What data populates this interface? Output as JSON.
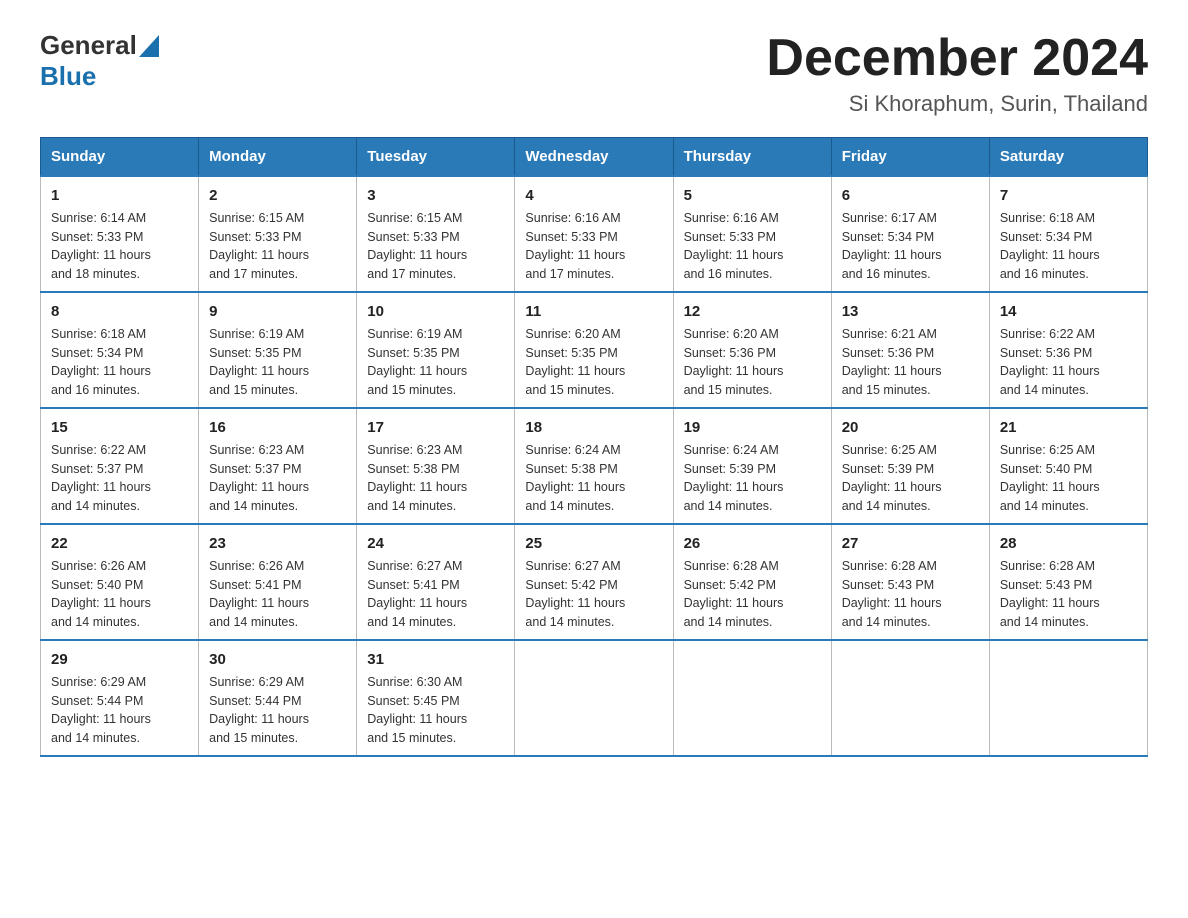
{
  "header": {
    "logo_general": "General",
    "logo_blue": "Blue",
    "month_year": "December 2024",
    "location": "Si Khoraphum, Surin, Thailand"
  },
  "days_of_week": [
    "Sunday",
    "Monday",
    "Tuesday",
    "Wednesday",
    "Thursday",
    "Friday",
    "Saturday"
  ],
  "weeks": [
    [
      {
        "day": "1",
        "sunrise": "6:14 AM",
        "sunset": "5:33 PM",
        "daylight": "11 hours and 18 minutes."
      },
      {
        "day": "2",
        "sunrise": "6:15 AM",
        "sunset": "5:33 PM",
        "daylight": "11 hours and 17 minutes."
      },
      {
        "day": "3",
        "sunrise": "6:15 AM",
        "sunset": "5:33 PM",
        "daylight": "11 hours and 17 minutes."
      },
      {
        "day": "4",
        "sunrise": "6:16 AM",
        "sunset": "5:33 PM",
        "daylight": "11 hours and 17 minutes."
      },
      {
        "day": "5",
        "sunrise": "6:16 AM",
        "sunset": "5:33 PM",
        "daylight": "11 hours and 16 minutes."
      },
      {
        "day": "6",
        "sunrise": "6:17 AM",
        "sunset": "5:34 PM",
        "daylight": "11 hours and 16 minutes."
      },
      {
        "day": "7",
        "sunrise": "6:18 AM",
        "sunset": "5:34 PM",
        "daylight": "11 hours and 16 minutes."
      }
    ],
    [
      {
        "day": "8",
        "sunrise": "6:18 AM",
        "sunset": "5:34 PM",
        "daylight": "11 hours and 16 minutes."
      },
      {
        "day": "9",
        "sunrise": "6:19 AM",
        "sunset": "5:35 PM",
        "daylight": "11 hours and 15 minutes."
      },
      {
        "day": "10",
        "sunrise": "6:19 AM",
        "sunset": "5:35 PM",
        "daylight": "11 hours and 15 minutes."
      },
      {
        "day": "11",
        "sunrise": "6:20 AM",
        "sunset": "5:35 PM",
        "daylight": "11 hours and 15 minutes."
      },
      {
        "day": "12",
        "sunrise": "6:20 AM",
        "sunset": "5:36 PM",
        "daylight": "11 hours and 15 minutes."
      },
      {
        "day": "13",
        "sunrise": "6:21 AM",
        "sunset": "5:36 PM",
        "daylight": "11 hours and 15 minutes."
      },
      {
        "day": "14",
        "sunrise": "6:22 AM",
        "sunset": "5:36 PM",
        "daylight": "11 hours and 14 minutes."
      }
    ],
    [
      {
        "day": "15",
        "sunrise": "6:22 AM",
        "sunset": "5:37 PM",
        "daylight": "11 hours and 14 minutes."
      },
      {
        "day": "16",
        "sunrise": "6:23 AM",
        "sunset": "5:37 PM",
        "daylight": "11 hours and 14 minutes."
      },
      {
        "day": "17",
        "sunrise": "6:23 AM",
        "sunset": "5:38 PM",
        "daylight": "11 hours and 14 minutes."
      },
      {
        "day": "18",
        "sunrise": "6:24 AM",
        "sunset": "5:38 PM",
        "daylight": "11 hours and 14 minutes."
      },
      {
        "day": "19",
        "sunrise": "6:24 AM",
        "sunset": "5:39 PM",
        "daylight": "11 hours and 14 minutes."
      },
      {
        "day": "20",
        "sunrise": "6:25 AM",
        "sunset": "5:39 PM",
        "daylight": "11 hours and 14 minutes."
      },
      {
        "day": "21",
        "sunrise": "6:25 AM",
        "sunset": "5:40 PM",
        "daylight": "11 hours and 14 minutes."
      }
    ],
    [
      {
        "day": "22",
        "sunrise": "6:26 AM",
        "sunset": "5:40 PM",
        "daylight": "11 hours and 14 minutes."
      },
      {
        "day": "23",
        "sunrise": "6:26 AM",
        "sunset": "5:41 PM",
        "daylight": "11 hours and 14 minutes."
      },
      {
        "day": "24",
        "sunrise": "6:27 AM",
        "sunset": "5:41 PM",
        "daylight": "11 hours and 14 minutes."
      },
      {
        "day": "25",
        "sunrise": "6:27 AM",
        "sunset": "5:42 PM",
        "daylight": "11 hours and 14 minutes."
      },
      {
        "day": "26",
        "sunrise": "6:28 AM",
        "sunset": "5:42 PM",
        "daylight": "11 hours and 14 minutes."
      },
      {
        "day": "27",
        "sunrise": "6:28 AM",
        "sunset": "5:43 PM",
        "daylight": "11 hours and 14 minutes."
      },
      {
        "day": "28",
        "sunrise": "6:28 AM",
        "sunset": "5:43 PM",
        "daylight": "11 hours and 14 minutes."
      }
    ],
    [
      {
        "day": "29",
        "sunrise": "6:29 AM",
        "sunset": "5:44 PM",
        "daylight": "11 hours and 14 minutes."
      },
      {
        "day": "30",
        "sunrise": "6:29 AM",
        "sunset": "5:44 PM",
        "daylight": "11 hours and 15 minutes."
      },
      {
        "day": "31",
        "sunrise": "6:30 AM",
        "sunset": "5:45 PM",
        "daylight": "11 hours and 15 minutes."
      },
      null,
      null,
      null,
      null
    ]
  ],
  "labels": {
    "sunrise": "Sunrise:",
    "sunset": "Sunset:",
    "daylight": "Daylight:"
  }
}
